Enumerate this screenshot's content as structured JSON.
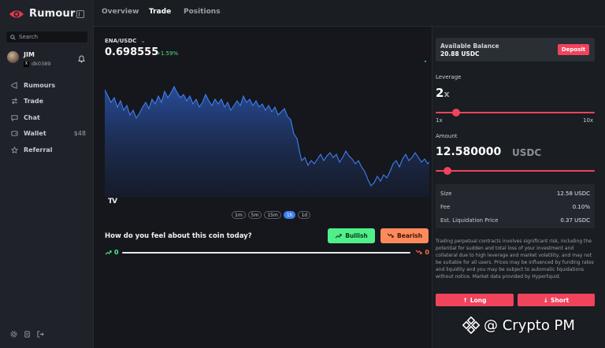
{
  "app": {
    "name": "Rumour"
  },
  "search": {
    "placeholder": "Search"
  },
  "user": {
    "name": "JIM",
    "handle": "dk0389"
  },
  "sidebar": {
    "items": [
      {
        "label": "Rumours",
        "icon": "megaphone-icon"
      },
      {
        "label": "Trade",
        "icon": "swap-icon"
      },
      {
        "label": "Chat",
        "icon": "chat-icon"
      },
      {
        "label": "Wallet",
        "icon": "wallet-icon",
        "value": "$48"
      },
      {
        "label": "Referral",
        "icon": "star-icon"
      }
    ]
  },
  "tabs": [
    {
      "label": "Overview",
      "active": false
    },
    {
      "label": "Trade",
      "active": true
    },
    {
      "label": "Positions",
      "active": false
    }
  ],
  "market": {
    "pair": "ENA/USDC",
    "price": "0.698555",
    "change": "+1.59%"
  },
  "timeframes": [
    {
      "label": "1m",
      "active": false
    },
    {
      "label": "5m",
      "active": false
    },
    {
      "label": "15m",
      "active": false
    },
    {
      "label": "1h",
      "active": true
    },
    {
      "label": "1d",
      "active": false
    }
  ],
  "sentiment": {
    "question": "How do you feel about this coin today?",
    "bullish_label": "Bullish",
    "bearish_label": "Bearish",
    "bullish_count": "0",
    "bearish_count": "0"
  },
  "panel": {
    "balance_label": "Available Balance",
    "balance_value": "20.88 USDC",
    "deposit_label": "Deposit",
    "leverage_label": "Leverage",
    "leverage_value": "2",
    "leverage_suffix": "x",
    "leverage_min": "1x",
    "leverage_max": "10x",
    "leverage_fraction": 0.11,
    "amount_label": "Amount",
    "amount_value": "12.580000",
    "amount_unit": "USDC",
    "amount_fraction": 0.05,
    "summary": [
      {
        "label": "Size",
        "value": "12.58 USDC"
      },
      {
        "label": "Fee",
        "value": "0.10%"
      },
      {
        "label": "Est. Liquidation Price",
        "value": "0.37 USDC"
      }
    ],
    "disclaimer": "Trading perpetual contracts involves significant risk, including the potential for sudden and total loss of your investment and collateral due to high leverage and market volatility, and may not be suitable for all users. Prices may be influenced by funding rates and liquidity and you may be subject to automatic liquidations without notice. Market data provided by Hyperliquid.",
    "long_label": "Long",
    "short_label": "Short"
  },
  "watermark": {
    "text": "@ Crypto PM"
  },
  "colors": {
    "accent": "#f0435c",
    "bullish": "#4ff08a",
    "bearish": "#ff8a5c",
    "chart_line": "#3f7ff0"
  }
}
